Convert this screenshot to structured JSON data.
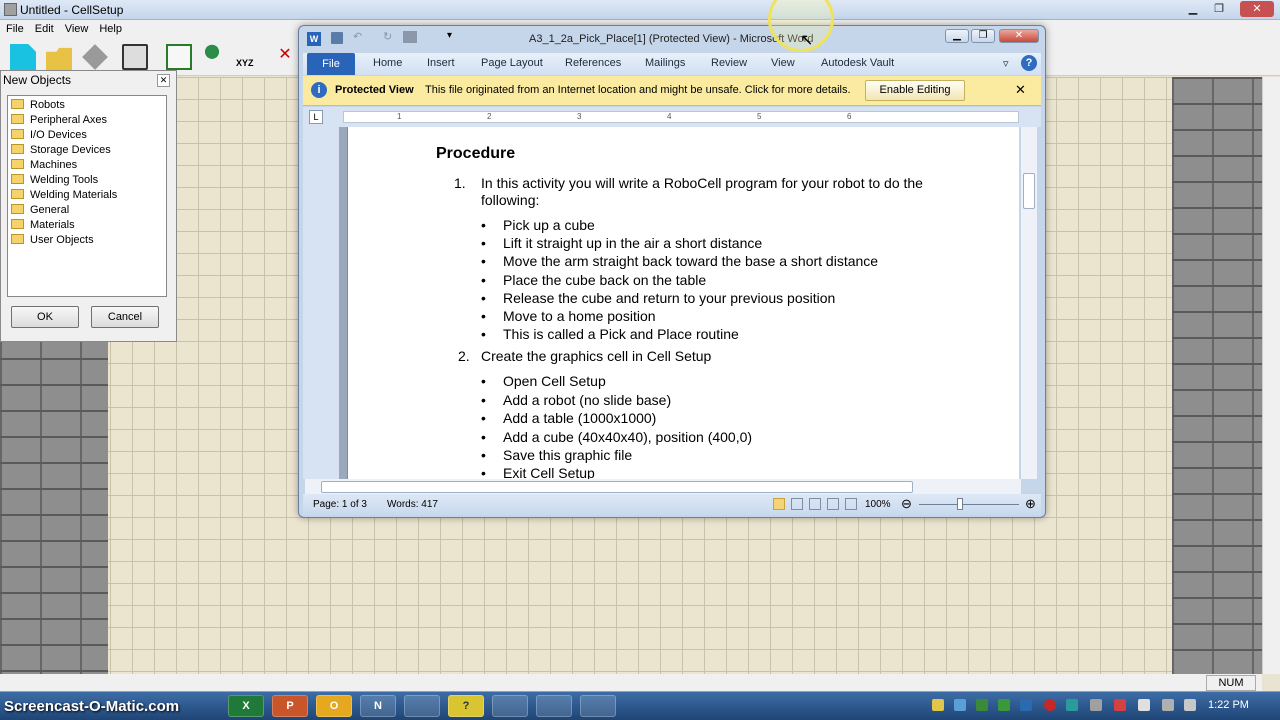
{
  "app": {
    "title": "Untitled - CellSetup",
    "menu": [
      "File",
      "Edit",
      "View",
      "Help"
    ],
    "toolbar_axis_label": "XYZ",
    "status_num": "NUM"
  },
  "new_objects": {
    "title": "New Objects",
    "items": [
      "Robots",
      "Peripheral Axes",
      "I/O Devices",
      "Storage Devices",
      "Machines",
      "Welding Tools",
      "Welding Materials",
      "General",
      "Materials",
      "User Objects"
    ],
    "ok": "OK",
    "cancel": "Cancel"
  },
  "word": {
    "title": "A3_1_2a_Pick_Place[1] (Protected View) - Microsoft Word",
    "tabs": [
      "File",
      "Home",
      "Insert",
      "Page Layout",
      "References",
      "Mailings",
      "Review",
      "View",
      "Autodesk Vault"
    ],
    "protected": {
      "label": "Protected View",
      "message": "This file originated from an Internet location and might be unsafe. Click for more details.",
      "enable": "Enable Editing"
    },
    "ruler": [
      "1",
      "2",
      "3",
      "4",
      "5",
      "6"
    ],
    "doc": {
      "heading": "Procedure",
      "step1_num": "1.",
      "step1_line1": "In this activity you will write a RoboCell program for your robot to do the",
      "step1_line2": "following:",
      "step1_bullets": [
        "Pick up a cube",
        "Lift it straight up in the air a  short distance",
        "Move the arm straight back toward the base a short distance",
        "Place the cube back on the table",
        "Release the cube and return to your previous position",
        "Move to a home position",
        "This is called a Pick and Place routine"
      ],
      "step2_num": "2.",
      "step2_text": "Create the graphics cell in Cell Setup",
      "step2_bullets": [
        "Open Cell Setup",
        "Add a robot (no slide base)",
        "Add a table (1000x1000)",
        "Add a cube (40x40x40), position (400,0)",
        "Save this graphic file",
        "Exit Cell Setup"
      ]
    },
    "status": {
      "page": "Page: 1 of 3",
      "words": "Words: 417",
      "zoom": "100%"
    }
  },
  "taskbar": {
    "logo": "Screencast-O-Matic.com",
    "clock": "1:22 PM",
    "apps": [
      "X",
      "P",
      "O",
      "N",
      "",
      "?",
      "",
      "",
      ""
    ]
  },
  "colors": {
    "word_blue": "#2a64b8",
    "pv_bar": "#fbeba1",
    "taskbar": "#1f4576"
  }
}
